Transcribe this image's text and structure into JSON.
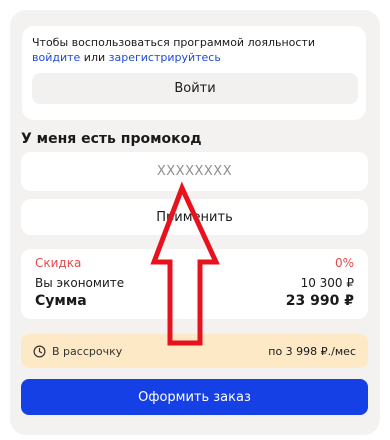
{
  "login": {
    "text_prefix": "Чтобы воспользоваться программой лояльности ",
    "login_link": "войдите",
    "text_or": " или ",
    "register_link": "зарегистрируйтесь",
    "button_label": "Войти"
  },
  "promo": {
    "title": "У меня есть промокод",
    "placeholder": "XXXXXXXX",
    "apply_label": "Применить"
  },
  "summary": {
    "discount_label": "Скидка",
    "discount_value": "0%",
    "save_label": "Вы экономите",
    "save_value": "10 300 ₽",
    "sum_label": "Сумма",
    "sum_value": "23 990 ₽"
  },
  "installment": {
    "label": "В рассрочку",
    "value": "по 3 998 ₽./мес",
    "icon": "clock-icon"
  },
  "order": {
    "button_label": "Оформить заказ"
  },
  "colors": {
    "accent_blue": "#1540e6",
    "link_blue": "#1f4bd8",
    "discount_red": "#e34a4a",
    "installment_bg": "#fde9c6",
    "annotation_arrow": "#e8121e"
  }
}
